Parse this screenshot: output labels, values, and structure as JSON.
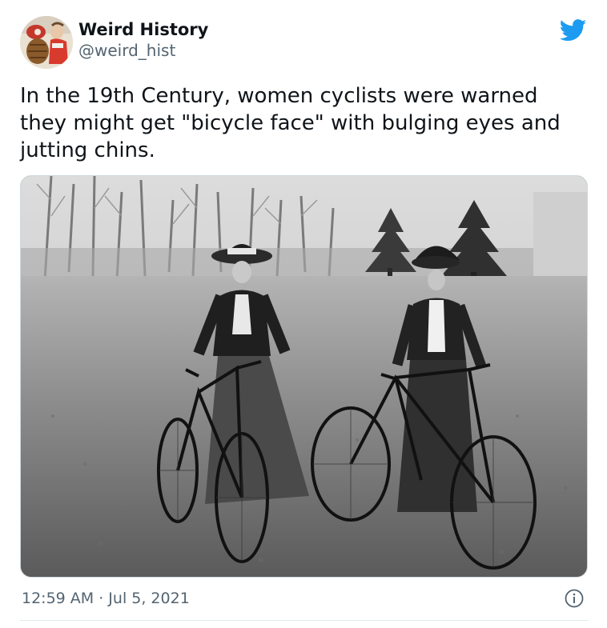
{
  "author": {
    "display_name": "Weird History",
    "handle": "@weird_hist",
    "avatar_icon": "avatar-image"
  },
  "brand": {
    "icon": "twitter-bird-icon",
    "color": "#1d9bf0"
  },
  "tweet": {
    "text": "In the 19th Century, women cyclists were warned they might get \"bicycle face\" with bulging eyes and jutting chins.",
    "timestamp": "12:59 AM · Jul 5, 2021"
  },
  "media": {
    "kind": "black-and-white photograph",
    "icon": "photo"
  },
  "colors": {
    "text": "#0f1419",
    "secondary_text": "#536471",
    "border": "#cfd9de"
  },
  "actions": {
    "info_icon": "info-circle-icon"
  }
}
